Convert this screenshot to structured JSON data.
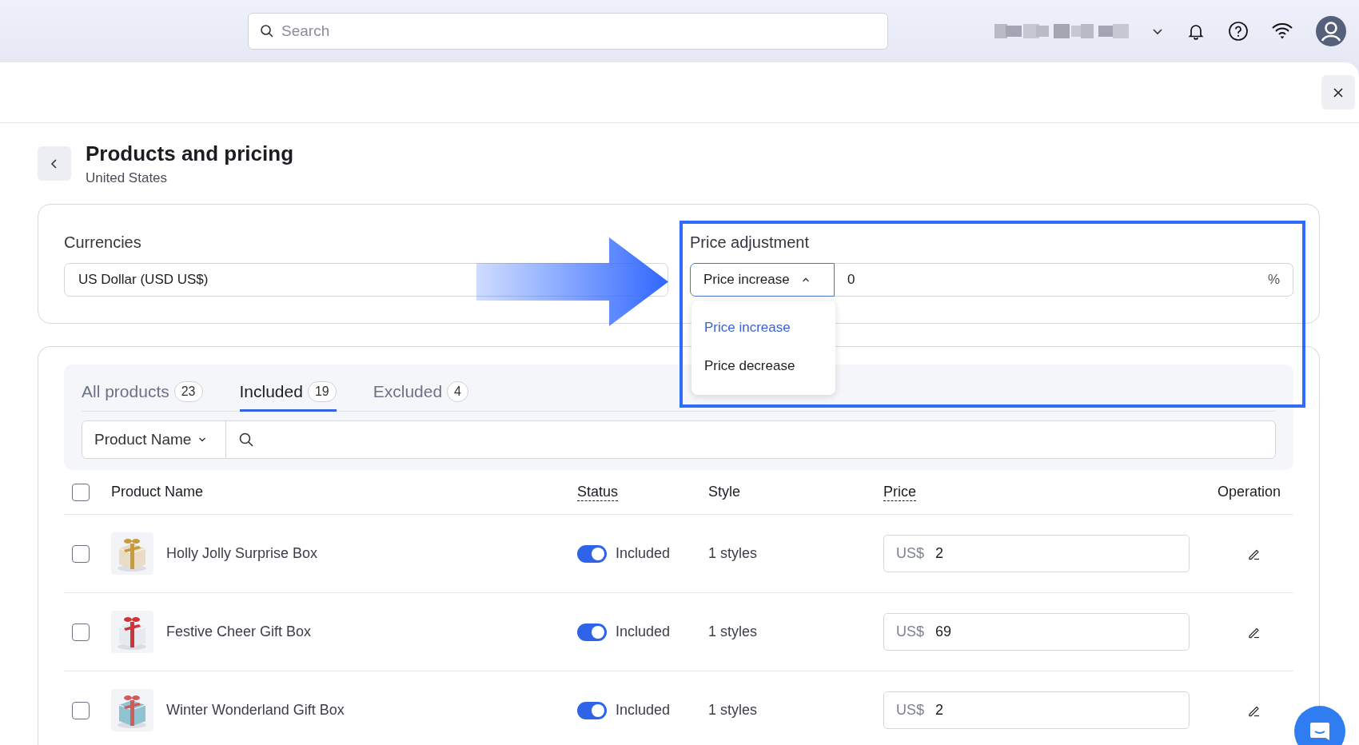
{
  "top_bar": {
    "search": {
      "placeholder": "Search"
    }
  },
  "page": {
    "title": "Products and pricing",
    "subtitle": "United States"
  },
  "currencies": {
    "label": "Currencies",
    "value": "US Dollar (USD US$)"
  },
  "price_adjustment": {
    "label": "Price adjustment",
    "mode": "Price increase",
    "expanded": true,
    "value": "0",
    "unit": "%",
    "options": [
      {
        "label": "Price increase",
        "selected": true
      },
      {
        "label": "Price decrease",
        "selected": false
      }
    ]
  },
  "tabs": [
    {
      "label": "All products",
      "count": "23",
      "selected": false
    },
    {
      "label": "Included",
      "count": "19",
      "selected": true
    },
    {
      "label": "Excluded",
      "count": "4",
      "selected": false
    }
  ],
  "filter": {
    "field": "Product Name"
  },
  "table": {
    "all_checked": false,
    "columns": [
      {
        "label": "Product Name",
        "tooltip": false
      },
      {
        "label": "Status",
        "tooltip": true
      },
      {
        "label": "Style",
        "tooltip": false
      },
      {
        "label": "Price",
        "tooltip": true
      },
      {
        "label": "Operation",
        "tooltip": false
      }
    ],
    "rows": [
      {
        "checked": false,
        "name": "Holly Jolly Surprise Box",
        "on": true,
        "status": "Included",
        "style": "1 styles",
        "currency": "US$",
        "price": "2"
      },
      {
        "checked": false,
        "name": "Festive Cheer Gift Box",
        "on": true,
        "status": "Included",
        "style": "1 styles",
        "currency": "US$",
        "price": "69"
      },
      {
        "checked": false,
        "name": "Winter Wonderland Gift Box",
        "on": true,
        "status": "Included",
        "style": "1 styles",
        "currency": "US$",
        "price": "2"
      }
    ]
  }
}
